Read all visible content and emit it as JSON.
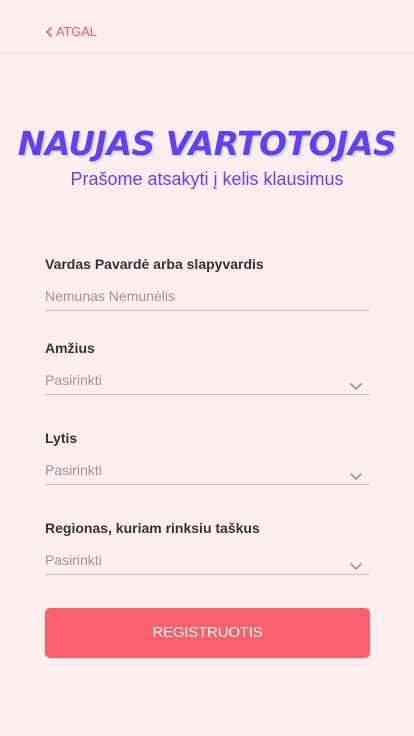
{
  "header": {
    "back_label": "ATGAL",
    "back_icon": "chevron-left-icon"
  },
  "hero": {
    "title": "NAUJAS VARTOTOJAS",
    "subtitle": "Prašome atsakyti į kelis klausimus"
  },
  "form": {
    "name": {
      "label": "Vardas Pavardė arba slapyvardis",
      "placeholder": "Nemunas Nemunėlis"
    },
    "age": {
      "label": "Amžius",
      "value": "Pasirinkti"
    },
    "gender": {
      "label": "Lytis",
      "value": "Pasirinkti"
    },
    "region": {
      "label": "Regionas, kuriam rinksiu taškus",
      "value": "Pasirinkti"
    },
    "submit_label": "REGISTRUOTIS"
  },
  "colors": {
    "background": "#fdeeee",
    "accent": "#fa5f6b",
    "title": "#6a3df2",
    "title_shadow": "#bfe8ff"
  }
}
